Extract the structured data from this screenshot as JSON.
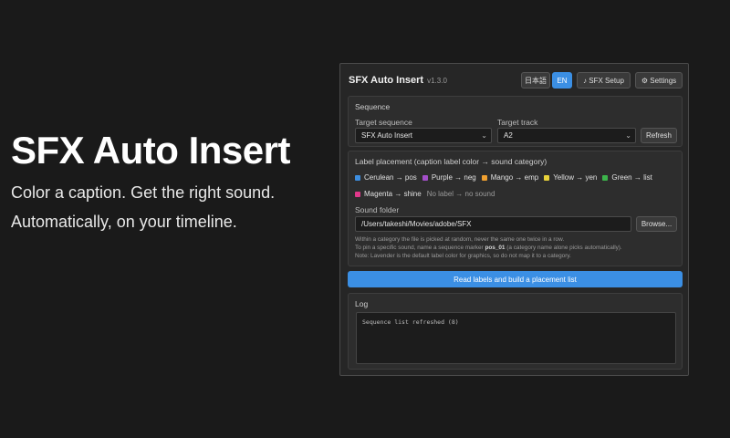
{
  "hero": {
    "title": "SFX Auto Insert",
    "line1": "Color a caption. Get the right sound.",
    "line2": "Automatically, on your timeline."
  },
  "panel": {
    "title": "SFX Auto Insert",
    "version": "v1.3.0",
    "lang_ja": "日本語",
    "lang_en": "EN",
    "sfx_setup": "♪ SFX Setup",
    "settings": "⚙ Settings"
  },
  "sequence": {
    "section_title": "Sequence",
    "target_sequence_label": "Target sequence",
    "target_sequence_value": "SFX Auto Insert",
    "target_track_label": "Target track",
    "target_track_value": "A2",
    "refresh": "Refresh"
  },
  "placement": {
    "section_title": "Label placement (caption label color → sound category)",
    "labels": [
      {
        "text": "Cerulean → pos",
        "color": "#3d8ee0"
      },
      {
        "text": "Purple → neg",
        "color": "#a34fc9"
      },
      {
        "text": "Mango → emp",
        "color": "#f0a030"
      },
      {
        "text": "Yellow → yen",
        "color": "#e8d23a"
      },
      {
        "text": "Green → list",
        "color": "#3cb44b"
      },
      {
        "text": "Magenta → shine",
        "color": "#e0388a"
      }
    ],
    "no_label": "No label → no sound",
    "sound_folder_label": "Sound folder",
    "sound_folder_value": "/Users/takeshi/Movies/adobe/SFX",
    "browse": "Browse...",
    "note1": "Within a category the file is picked at random, never the same one twice in a row.",
    "note2_pre": "To pin a specific sound, name a sequence marker ",
    "note2_bold": "pos_01",
    "note2_post": " (a category name alone picks automatically).",
    "note3": "Note: Lavender is the default label color for graphics, so do not map it to a category."
  },
  "action": {
    "build": "Read labels and build a placement list"
  },
  "log": {
    "title": "Log",
    "text": "Sequence list refreshed (8)"
  }
}
